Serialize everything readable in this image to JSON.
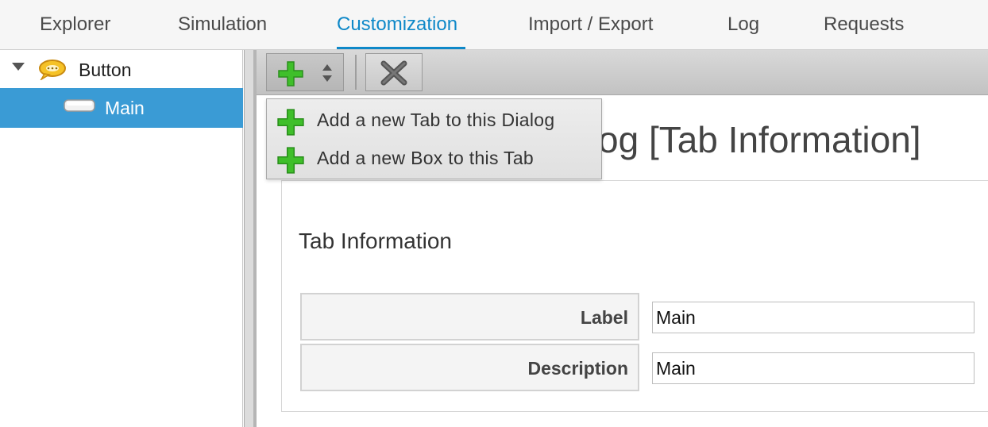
{
  "nav": {
    "tabs": [
      {
        "label": "Explorer",
        "active": false
      },
      {
        "label": "Simulation",
        "active": false
      },
      {
        "label": "Customization",
        "active": true
      },
      {
        "label": "Import / Export",
        "active": false
      },
      {
        "label": "Log",
        "active": false
      },
      {
        "label": "Requests",
        "active": false
      }
    ],
    "accent_color": "#0e88c8"
  },
  "tree": {
    "root": {
      "label": "Button",
      "icon": "speech-bubble-icon",
      "expanded": true
    },
    "children": [
      {
        "label": "Main",
        "icon": "button-icon",
        "selected": true
      }
    ],
    "selected_color": "#3a9bd5"
  },
  "toolbar": {
    "add_icon": "plus-icon",
    "arrows_icon": "up-down-arrows-icon",
    "delete_icon": "x-icon"
  },
  "dropdown": {
    "items": [
      {
        "label": "Add a new Tab to this Dialog",
        "icon": "plus-icon"
      },
      {
        "label": "Add a new Box to this Tab",
        "icon": "plus-icon"
      }
    ]
  },
  "main": {
    "heading_visible": "og [Tab Information]",
    "panel_title": "Tab Information",
    "fields": [
      {
        "label": "Label",
        "value": "Main"
      },
      {
        "label": "Description",
        "value": "Main"
      }
    ]
  }
}
